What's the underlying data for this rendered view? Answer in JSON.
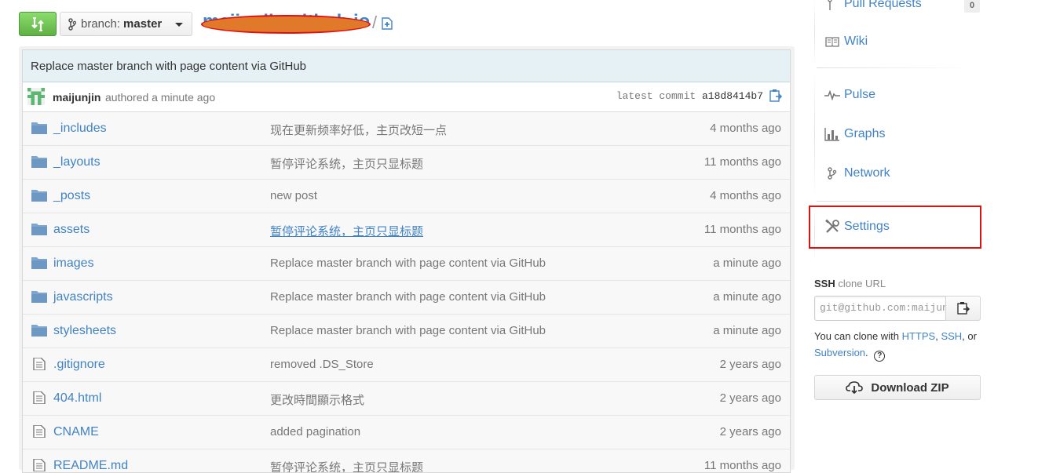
{
  "header": {
    "branch_prefix": "branch:",
    "branch_name": "master",
    "repo_name": "maijunjin.github.io",
    "path_separator": "/"
  },
  "commit": {
    "message": "Replace master branch with page content via GitHub",
    "author": "maijunjin",
    "authored_text": "authored a minute ago",
    "latest_label": "latest commit",
    "sha": "a18d8414b7"
  },
  "files": [
    {
      "type": "folder",
      "name": "_includes",
      "message": "现在更新频率好低，主页改短一点",
      "age": "4 months ago"
    },
    {
      "type": "folder",
      "name": "_layouts",
      "message": "暂停评论系统，主页只显标题",
      "age": "11 months ago"
    },
    {
      "type": "folder",
      "name": "_posts",
      "message": "new post",
      "age": "4 months ago"
    },
    {
      "type": "folder",
      "name": "assets",
      "message": "暂停评论系统，主页只显标题",
      "age": "11 months ago"
    },
    {
      "type": "folder",
      "name": "images",
      "message": "Replace master branch with page content via GitHub",
      "age": "a minute ago"
    },
    {
      "type": "folder",
      "name": "javascripts",
      "message": "Replace master branch with page content via GitHub",
      "age": "a minute ago"
    },
    {
      "type": "folder",
      "name": "stylesheets",
      "message": "Replace master branch with page content via GitHub",
      "age": "a minute ago"
    },
    {
      "type": "file",
      "name": ".gitignore",
      "message": "removed .DS_Store",
      "age": "2 years ago"
    },
    {
      "type": "file",
      "name": "404.html",
      "message": "更改時間顯示格式",
      "age": "2 years ago"
    },
    {
      "type": "file",
      "name": "CNAME",
      "message": "added pagination",
      "age": "2 years ago"
    },
    {
      "type": "file",
      "name": "README.md",
      "message": "暂停评论系统，主页只显标题",
      "age": "11 months ago"
    }
  ],
  "sidebar": {
    "pull_requests": {
      "label": "Pull Requests",
      "count": "0"
    },
    "wiki": "Wiki",
    "pulse": "Pulse",
    "graphs": "Graphs",
    "network": "Network",
    "settings": "Settings"
  },
  "clone": {
    "ssh_label": "SSH",
    "clone_url_label": "clone URL",
    "url_value": "git@github.com:maijunjin/maijunjin.github.io.git",
    "help_prefix": "You can clone with",
    "https": "HTTPS",
    "comma1": ",",
    "ssh": "SSH",
    "comma2": ",",
    "or": "or",
    "subversion": "Subversion",
    "period": ".",
    "help_icon": "?",
    "download_label": "Download ZIP"
  },
  "colors": {
    "accent": "#4183c4",
    "compare_button": "#60b044",
    "annotation": "#e01010",
    "redaction": "#e07a2a"
  }
}
